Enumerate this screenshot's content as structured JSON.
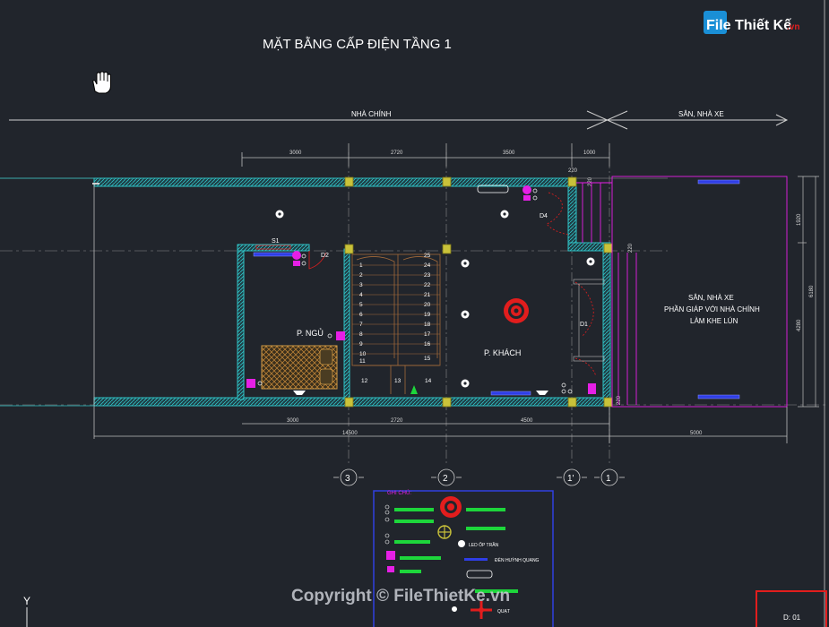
{
  "title": "MẶT BẰNG CẤP ĐIỆN TẦNG 1",
  "logo": {
    "text": "File Thiết Kế",
    "suffix": ".vn"
  },
  "copyright": "Copyright © FileThietKe.vn",
  "zones": {
    "main": "NHÀ CHÍNH",
    "yard": "SÂN, NHÀ XE"
  },
  "dims_top": [
    "3000",
    "2720",
    "3500",
    "1000"
  ],
  "dims_bottom": [
    "3000",
    "2720",
    "4500"
  ],
  "dim_total": "14500",
  "dim_yard": "5000",
  "dims_small": [
    "220",
    "220",
    "220",
    "220"
  ],
  "dims_right": [
    "1920",
    "4280",
    "6180"
  ],
  "rooms": {
    "bedroom": "P. NGỦ",
    "living": "P. KHÁCH"
  },
  "yard_note": [
    "SÂN, NHÀ XE",
    "PHẦN GIÁP VỚI NHÀ CHÍNH",
    "LÀM KHE LÚN"
  ],
  "door_tags": [
    "D2",
    "D4",
    "D1"
  ],
  "switch_tag": "S1",
  "stairs_left": [
    "1",
    "2",
    "3",
    "4",
    "5",
    "6",
    "7",
    "8",
    "9",
    "10",
    "11"
  ],
  "stairs_right": [
    "25",
    "24",
    "23",
    "22",
    "21",
    "20",
    "19",
    "18",
    "17",
    "16",
    "15"
  ],
  "stairs_bottom": [
    "12",
    "13",
    "14"
  ],
  "grid_axes": [
    "3",
    "2",
    "1'",
    "1"
  ],
  "legend": {
    "title": "GHI CHÚ:",
    "items": [
      "LED ỐP TRẦN",
      "ĐÈN HUỲNH QUANG",
      "QUẠT"
    ]
  },
  "sheet_no": "D: 01",
  "ucs": "Y",
  "colors": {
    "background": "#21252c",
    "wall": "#2fc3c6",
    "column": "#c9c23a",
    "stair": "#a36a3a",
    "magenta": "#e61fe6",
    "red": "#e21d1d",
    "green": "#1dd63b",
    "blue": "#3040e0"
  }
}
